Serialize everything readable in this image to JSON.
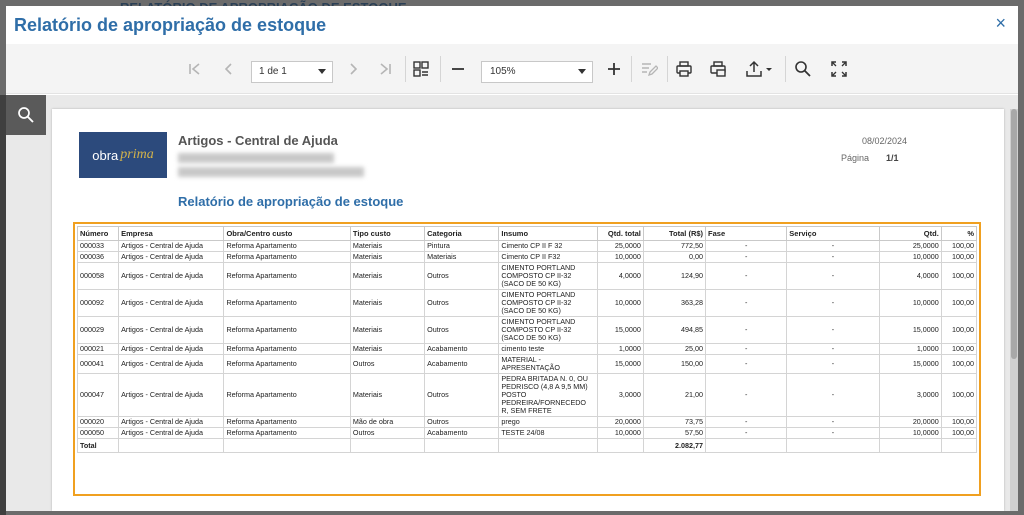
{
  "backdrop": {
    "title": "RELATÓRIO DE APROPRIAÇÃO DE ESTOQUE"
  },
  "modal": {
    "title": "Relatório de apropriação de estoque",
    "close_label": "×"
  },
  "toolbar": {
    "page_select_value": "1 de 1",
    "zoom_select_value": "105%",
    "icons": [
      "first-page-icon",
      "prev-page-icon",
      "next-page-icon",
      "last-page-icon",
      "multi-page-icon",
      "zoom-out-icon",
      "zoom-in-icon",
      "edit-icon",
      "print-icon",
      "print-page-icon",
      "export-icon",
      "search-icon",
      "fullscreen-icon"
    ]
  },
  "report": {
    "company": "Artigos - Central de Ajuda",
    "date": "08/02/2024",
    "page_label": "Página",
    "page_value": "1/1",
    "title": "Relatório de apropriação de estoque",
    "logo_text_a": "obra",
    "logo_text_b": "prima",
    "columns": [
      "Número",
      "Empresa",
      "Obra/Centro custo",
      "Tipo custo",
      "Categoria",
      "Insumo",
      "Qtd. total",
      "Total (R$)",
      "Fase",
      "Serviço",
      "Qtd.",
      "%"
    ],
    "rows": [
      {
        "numero": "000033",
        "empresa": "Artigos - Central de Ajuda",
        "obra": "Reforma Apartamento",
        "tipo": "Materiais",
        "categoria": "Pintura",
        "insumo": "Cimento CP II F 32",
        "qtd_total": "25,0000",
        "total": "772,50",
        "fase": "-",
        "servico": "-",
        "qtd": "25,0000",
        "pct": "100,00"
      },
      {
        "numero": "000036",
        "empresa": "Artigos - Central de Ajuda",
        "obra": "Reforma Apartamento",
        "tipo": "Materiais",
        "categoria": "Materiais",
        "insumo": "Cimento CP II F32",
        "qtd_total": "10,0000",
        "total": "0,00",
        "fase": "-",
        "servico": "-",
        "qtd": "10,0000",
        "pct": "100,00"
      },
      {
        "numero": "000058",
        "empresa": "Artigos - Central de Ajuda",
        "obra": "Reforma Apartamento",
        "tipo": "Materiais",
        "categoria": "Outros",
        "insumo": "CIMENTO PORTLAND COMPOSTO CP II-32 (SACO DE 50 KG)",
        "qtd_total": "4,0000",
        "total": "124,90",
        "fase": "-",
        "servico": "-",
        "qtd": "4,0000",
        "pct": "100,00"
      },
      {
        "numero": "000092",
        "empresa": "Artigos - Central de Ajuda",
        "obra": "Reforma Apartamento",
        "tipo": "Materiais",
        "categoria": "Outros",
        "insumo": "CIMENTO PORTLAND COMPOSTO CP II-32 (SACO DE 50 KG)",
        "qtd_total": "10,0000",
        "total": "363,28",
        "fase": "-",
        "servico": "-",
        "qtd": "10,0000",
        "pct": "100,00"
      },
      {
        "numero": "000029",
        "empresa": "Artigos - Central de Ajuda",
        "obra": "Reforma Apartamento",
        "tipo": "Materiais",
        "categoria": "Outros",
        "insumo": "CIMENTO PORTLAND COMPOSTO CP II-32 (SACO DE 50 KG)",
        "qtd_total": "15,0000",
        "total": "494,85",
        "fase": "-",
        "servico": "-",
        "qtd": "15,0000",
        "pct": "100,00"
      },
      {
        "numero": "000021",
        "empresa": "Artigos - Central de Ajuda",
        "obra": "Reforma Apartamento",
        "tipo": "Materiais",
        "categoria": "Acabamento",
        "insumo": "cimento teste",
        "qtd_total": "1,0000",
        "total": "25,00",
        "fase": "-",
        "servico": "-",
        "qtd": "1,0000",
        "pct": "100,00"
      },
      {
        "numero": "000041",
        "empresa": "Artigos - Central de Ajuda",
        "obra": "Reforma Apartamento",
        "tipo": "Outros",
        "categoria": "Acabamento",
        "insumo": "MATERIAL - APRESENTAÇÃO",
        "qtd_total": "15,0000",
        "total": "150,00",
        "fase": "-",
        "servico": "-",
        "qtd": "15,0000",
        "pct": "100,00"
      },
      {
        "numero": "000047",
        "empresa": "Artigos - Central de Ajuda",
        "obra": "Reforma Apartamento",
        "tipo": "Materiais",
        "categoria": "Outros",
        "insumo": "PEDRA BRITADA N. 0, OU PEDRISCO (4,8 A 9,5 MM) POSTO PEDREIRA/FORNECEDO R, SEM FRETE",
        "qtd_total": "3,0000",
        "total": "21,00",
        "fase": "-",
        "servico": "-",
        "qtd": "3,0000",
        "pct": "100,00"
      },
      {
        "numero": "000020",
        "empresa": "Artigos - Central de Ajuda",
        "obra": "Reforma Apartamento",
        "tipo": "Mão de obra",
        "categoria": "Outros",
        "insumo": "prego",
        "qtd_total": "20,0000",
        "total": "73,75",
        "fase": "-",
        "servico": "-",
        "qtd": "20,0000",
        "pct": "100,00"
      },
      {
        "numero": "000050",
        "empresa": "Artigos - Central de Ajuda",
        "obra": "Reforma Apartamento",
        "tipo": "Outros",
        "categoria": "Acabamento",
        "insumo": "TESTE 24/08",
        "qtd_total": "10,0000",
        "total": "57,50",
        "fase": "-",
        "servico": "-",
        "qtd": "10,0000",
        "pct": "100,00"
      }
    ],
    "total_label": "Total",
    "total_value": "2.082,77"
  }
}
